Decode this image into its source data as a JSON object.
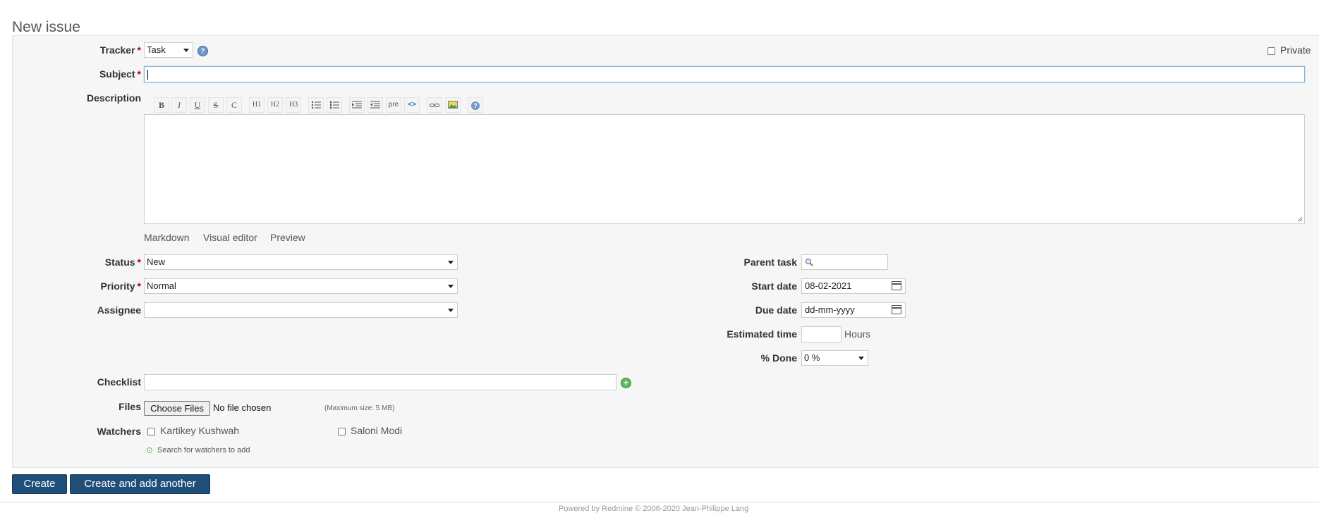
{
  "page": {
    "title": "New issue"
  },
  "form": {
    "tracker": {
      "label": "Tracker",
      "required_mark": "*",
      "value": "Task"
    },
    "private": {
      "label": "Private",
      "checked": false
    },
    "subject": {
      "label": "Subject",
      "required_mark": "*",
      "value": ""
    },
    "description": {
      "label": "Description"
    },
    "toolbar": [
      "B",
      "I",
      "U",
      "S",
      "C",
      "H1",
      "H2",
      "H3",
      "ul",
      "ol",
      "indent",
      "outdent",
      "pre",
      "code",
      "link",
      "image",
      "help"
    ],
    "editor_tabs": [
      "Markdown",
      "Visual editor",
      "Preview"
    ],
    "status": {
      "label": "Status",
      "required_mark": "*",
      "value": "New"
    },
    "priority": {
      "label": "Priority",
      "required_mark": "*",
      "value": "Normal"
    },
    "assignee": {
      "label": "Assignee",
      "value": ""
    },
    "parent_task": {
      "label": "Parent task",
      "value": ""
    },
    "start_date": {
      "label": "Start date",
      "value": "08-02-2021"
    },
    "due_date": {
      "label": "Due date",
      "value": "dd-mm-yyyy"
    },
    "estimated_time": {
      "label": "Estimated time",
      "value": "",
      "unit": "Hours"
    },
    "done": {
      "label": "% Done",
      "value": "0 %"
    },
    "checklist": {
      "label": "Checklist",
      "value": ""
    },
    "files": {
      "label": "Files",
      "button": "Choose Files",
      "status": "No file chosen",
      "max_size": "(Maximum size: 5 MB)"
    },
    "watchers": {
      "label": "Watchers",
      "users": [
        {
          "name": "Kartikey Kushwah",
          "checked": false
        },
        {
          "name": "Saloni Modi",
          "checked": false
        }
      ],
      "search_link": "Search for watchers to add"
    }
  },
  "actions": {
    "create": "Create",
    "create_another": "Create and add another"
  },
  "footer": {
    "text": "Powered by Redmine © 2006-2020 Jean-Philippe Lang"
  },
  "colors": {
    "accent": "#1f4e79",
    "required": "#bb0000",
    "panel": "#f6f6f6",
    "add_icon": "#5cb85c"
  }
}
